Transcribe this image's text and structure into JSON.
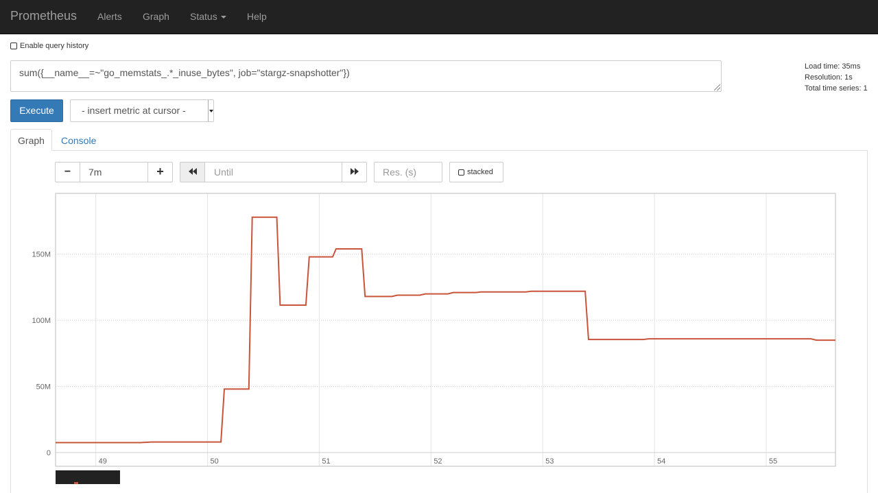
{
  "navbar": {
    "brand": "Prometheus",
    "links": [
      "Alerts",
      "Graph",
      "Status",
      "Help"
    ]
  },
  "history": {
    "label": "Enable query history",
    "checked": false
  },
  "query": {
    "expression": "sum({__name__=~\"go_memstats_.*_inuse_bytes\", job=\"stargz-snapshotter\"})",
    "load_time": "Load time: 35ms",
    "resolution": "Resolution: 1s",
    "total_series": "Total time series: 1"
  },
  "actions": {
    "execute": "Execute",
    "metric_select": "- insert metric at cursor -"
  },
  "tabs": [
    {
      "label": "Graph",
      "active": true
    },
    {
      "label": "Console",
      "active": false
    }
  ],
  "graph_controls": {
    "minus": "−",
    "range": "7m",
    "plus": "+",
    "back_icon": "fast-backward-icon",
    "until_placeholder": "Until",
    "forward_icon": "fast-forward-icon",
    "res_placeholder": "Res. (s)",
    "stacked_label": "stacked"
  },
  "colors": {
    "series": "#c9543a",
    "navbar": "#222222",
    "primary": "#337ab7"
  },
  "chart_data": {
    "type": "line",
    "xlim": [
      48.64,
      55.62
    ],
    "ylim": [
      0,
      180
    ],
    "x_ticks": [
      49,
      50,
      51,
      52,
      53,
      54,
      55
    ],
    "x_tick_labels": [
      "49",
      "50",
      "51",
      "52",
      "53",
      "54",
      "55"
    ],
    "y_ticks": [
      0,
      50,
      100,
      150
    ],
    "y_tick_labels": [
      "0",
      "50M",
      "100M",
      "150M"
    ],
    "grid": true,
    "series": [
      {
        "points": [
          [
            48.64,
            7.5
          ],
          [
            49.4,
            7.5
          ],
          [
            49.5,
            8
          ],
          [
            50.12,
            8
          ],
          [
            50.15,
            48
          ],
          [
            50.37,
            48
          ],
          [
            50.4,
            178
          ],
          [
            50.62,
            178
          ],
          [
            50.65,
            111.5
          ],
          [
            50.88,
            111.5
          ],
          [
            50.91,
            148
          ],
          [
            51.12,
            148
          ],
          [
            51.15,
            154
          ],
          [
            51.38,
            154
          ],
          [
            51.41,
            118
          ],
          [
            51.65,
            118
          ],
          [
            51.7,
            119
          ],
          [
            51.9,
            119
          ],
          [
            51.95,
            120
          ],
          [
            52.15,
            120
          ],
          [
            52.2,
            121
          ],
          [
            52.4,
            121
          ],
          [
            52.45,
            121.5
          ],
          [
            52.85,
            121.5
          ],
          [
            52.9,
            122
          ],
          [
            53.38,
            122
          ],
          [
            53.41,
            85.5
          ],
          [
            53.9,
            85.5
          ],
          [
            53.95,
            86
          ],
          [
            55.4,
            86
          ],
          [
            55.45,
            85
          ],
          [
            55.62,
            85
          ]
        ]
      }
    ]
  }
}
